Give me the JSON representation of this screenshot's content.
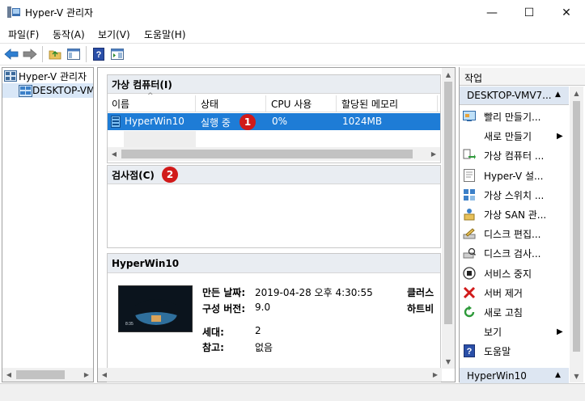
{
  "window": {
    "title": "Hyper-V 관리자",
    "minimize": "—",
    "maximize": "☐",
    "close": "✕"
  },
  "menu": [
    "파일(F)",
    "동작(A)",
    "보기(V)",
    "도움말(H)"
  ],
  "tree": {
    "root": "Hyper-V 관리자",
    "child": "DESKTOP-VMV"
  },
  "vms_section": {
    "title": "가상 컴퓨터(I)",
    "columns": [
      "이름",
      "상태",
      "CPU 사용",
      "할당된 메모리"
    ],
    "row": {
      "name": "HyperWin10",
      "state": "실행 중",
      "cpu": "0%",
      "memory": "1024MB"
    }
  },
  "checkpoints_section": {
    "title": "검사점(C)"
  },
  "details": {
    "title": "HyperWin10",
    "created_label": "만든 날짜:",
    "created_value": "2019-04-28 오후 4:30:55",
    "config_label": "구성 버전:",
    "config_value": "9.0",
    "gen_label": "세대:",
    "gen_value": "2",
    "notes_label": "참고:",
    "notes_value": "없음",
    "right_label_1": "클러스",
    "right_label_2": "하트비"
  },
  "badges": {
    "one": "1",
    "two": "2"
  },
  "actions": {
    "header": "작업",
    "group1": "DESKTOP-VMV7...",
    "items": [
      {
        "label": "빨리 만들기...",
        "icon": "quick-create-icon"
      },
      {
        "label": "새로 만들기",
        "icon": "none",
        "submenu": "▶"
      },
      {
        "label": "가상 컴퓨터 ...",
        "icon": "import-vm-icon"
      },
      {
        "label": "Hyper-V 설...",
        "icon": "hyperv-settings-icon"
      },
      {
        "label": "가상 스위치 ...",
        "icon": "virtual-switch-icon"
      },
      {
        "label": "가상 SAN 관...",
        "icon": "virtual-san-icon"
      },
      {
        "label": "디스크 편집...",
        "icon": "edit-disk-icon"
      },
      {
        "label": "디스크 검사...",
        "icon": "inspect-disk-icon"
      },
      {
        "label": "서비스 중지",
        "icon": "stop-service-icon"
      },
      {
        "label": "서버 제거",
        "icon": "remove-server-icon"
      },
      {
        "label": "새로 고침",
        "icon": "refresh-icon"
      },
      {
        "label": "보기",
        "icon": "none",
        "submenu": "▶"
      },
      {
        "label": "도움말",
        "icon": "help-icon"
      }
    ],
    "group2": "HyperWin10"
  },
  "colors": {
    "selection": "#1e7cd6",
    "badge": "#d11a1a",
    "section_head": "#e9edf2",
    "action_head": "#dde6f2"
  }
}
